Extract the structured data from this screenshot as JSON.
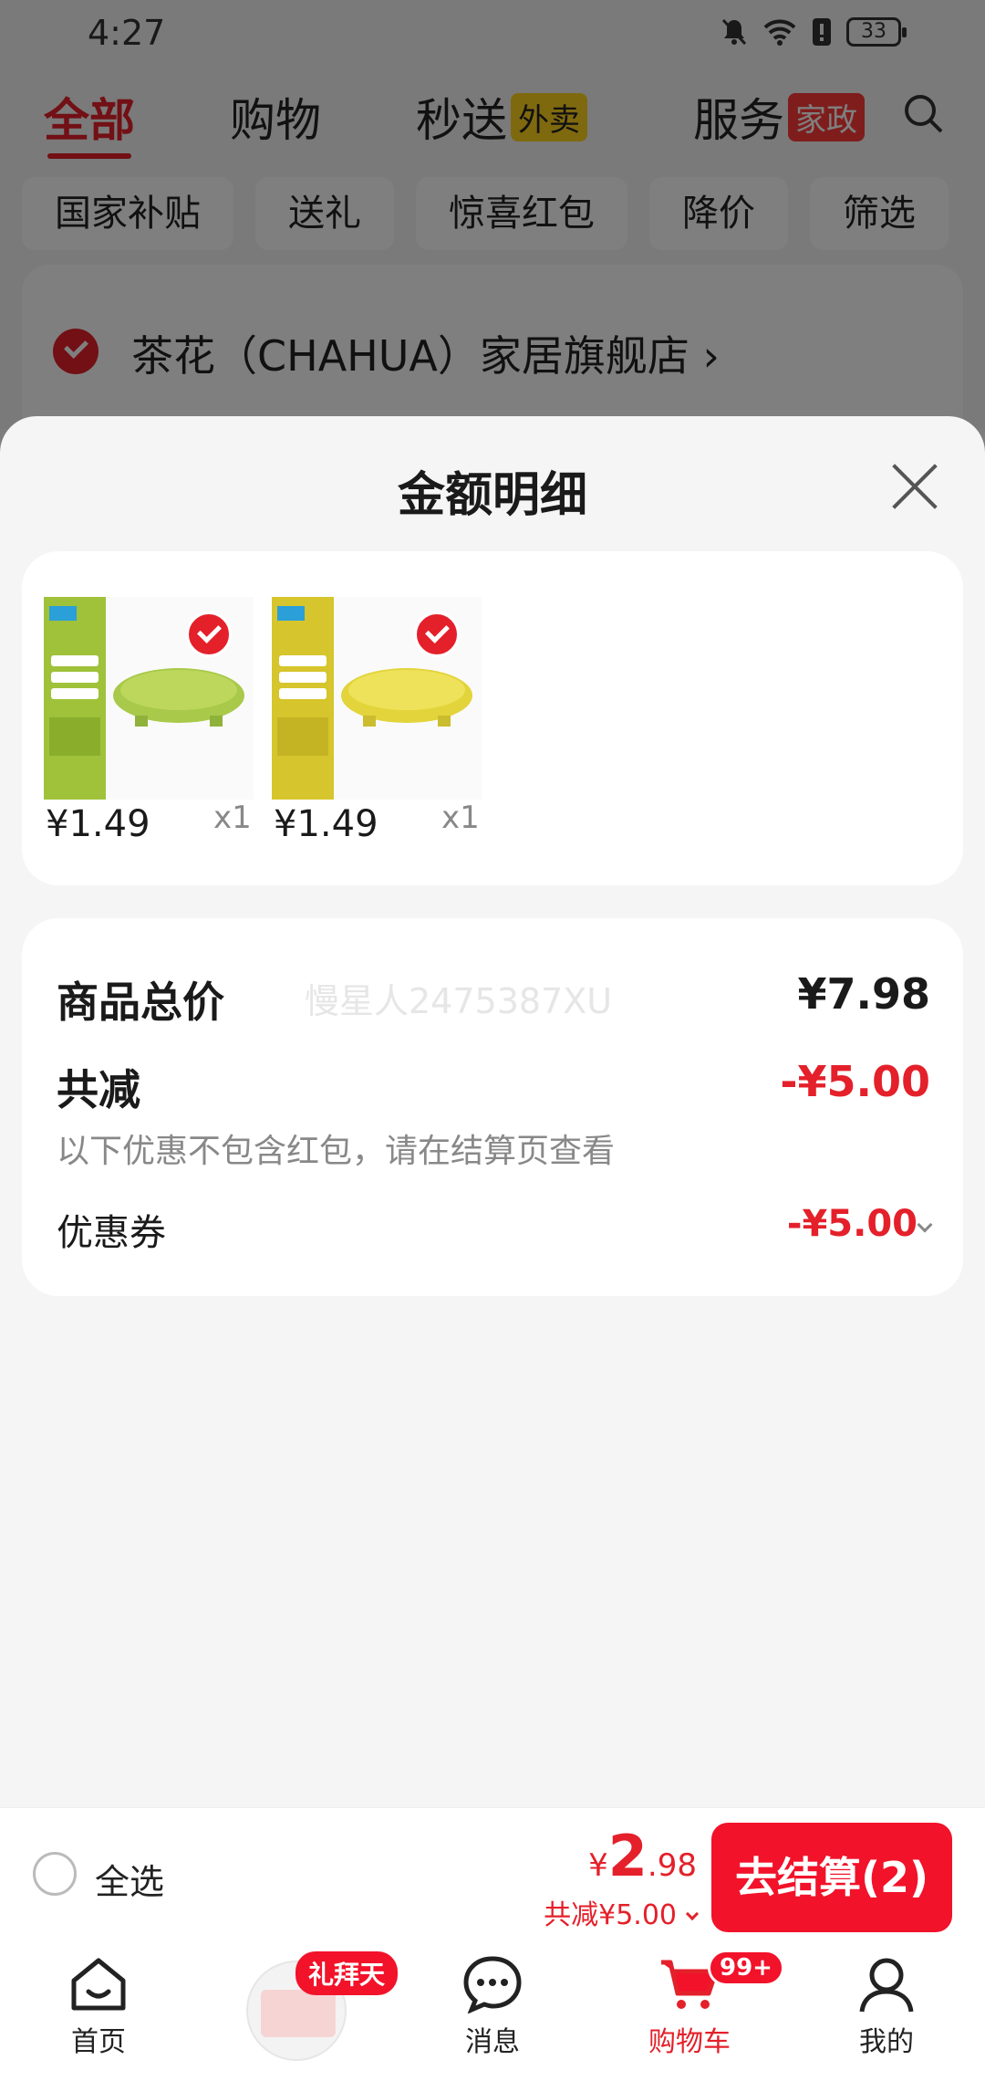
{
  "status_bar": {
    "time": "4:27",
    "battery": "33"
  },
  "top_tabs": [
    {
      "label": "全部"
    },
    {
      "label": "购物"
    },
    {
      "label": "秒送",
      "badge": "外卖"
    },
    {
      "label": "服务",
      "badge": "家政"
    }
  ],
  "filters": [
    "国家补贴",
    "送礼",
    "惊喜红包",
    "降价",
    "筛选"
  ],
  "store": {
    "name": "茶花（CHAHUA）家居旗舰店 ›"
  },
  "sheet": {
    "title": "金额明细",
    "items": [
      {
        "price": "¥1.49",
        "qty": "x1",
        "color": "#9fc23a"
      },
      {
        "price": "¥1.49",
        "qty": "x1",
        "color": "#e2d43a"
      }
    ],
    "summary": {
      "subtotal_label": "商品总价",
      "subtotal_value": "¥7.98",
      "watermark": "慢星人2475387XU",
      "discount_label": "共减",
      "discount_value": "-¥5.00",
      "discount_note": "以下优惠不包含红包，请在结算页查看",
      "coupon_label": "优惠券",
      "coupon_value": "-¥5.00"
    }
  },
  "checkout": {
    "select_all": "全选",
    "currency": "¥",
    "total_int": "2",
    "total_dec": ".98",
    "saved": "共减¥5.00",
    "button": "去结算(2)"
  },
  "nav": {
    "home": "首页",
    "promo_badge": "礼拜天",
    "messages": "消息",
    "cart": "购物车",
    "cart_badge": "99+",
    "me": "我的"
  },
  "colors": {
    "accent": "#e4202a",
    "button": "#f2122a"
  }
}
